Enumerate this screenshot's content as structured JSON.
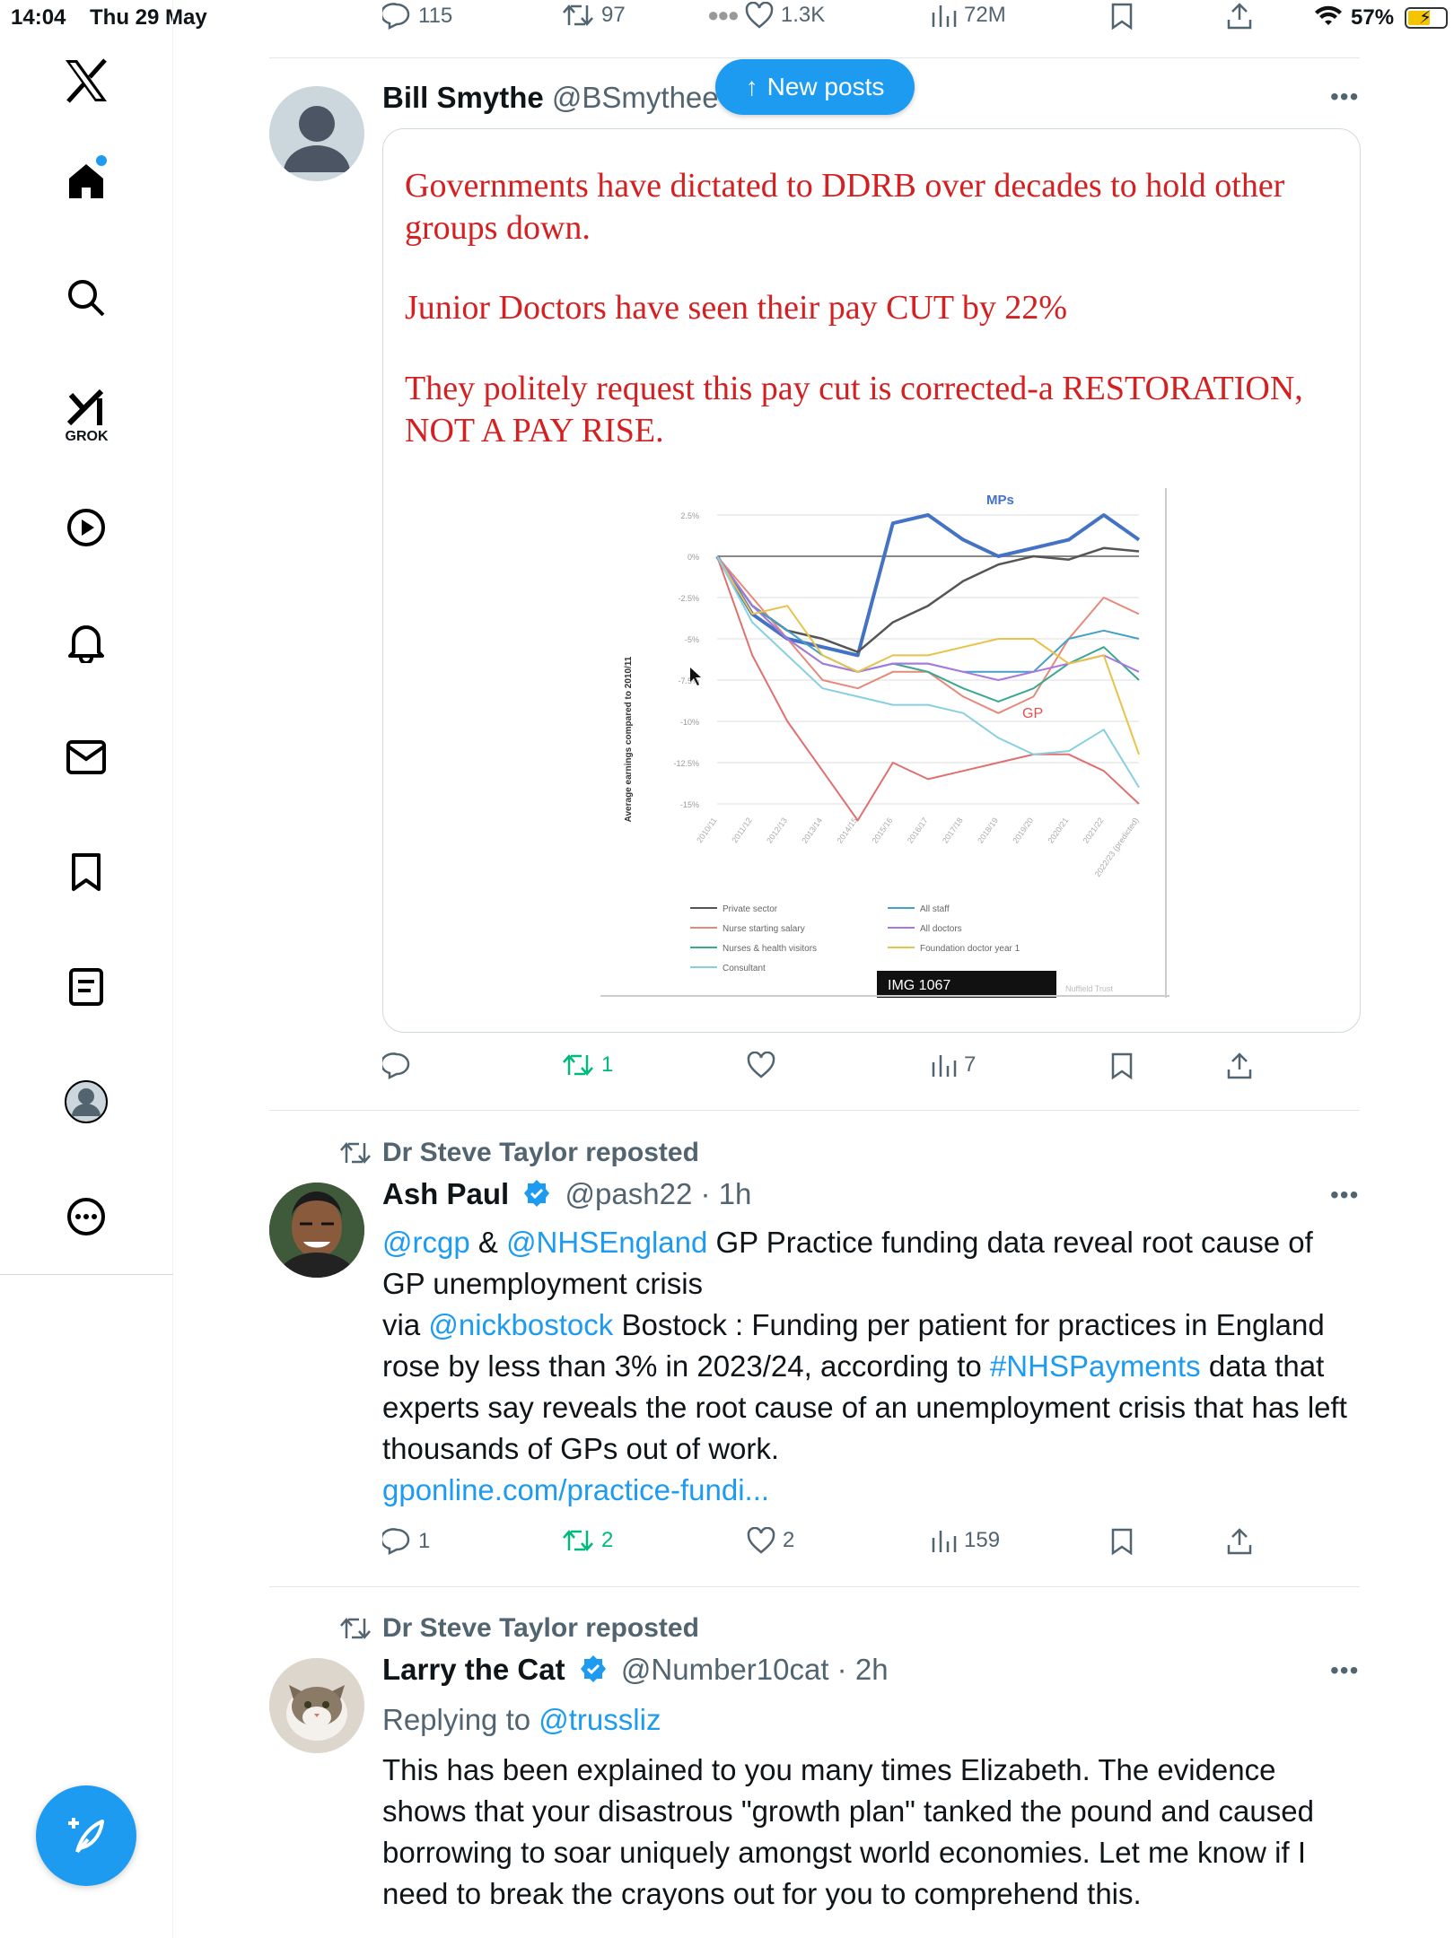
{
  "status": {
    "time": "14:04",
    "date": "Thu 29 May",
    "battery": "57%"
  },
  "sidebar": {
    "grok_label": "GROK"
  },
  "top_actions": {
    "replies": "115",
    "reposts": "97",
    "likes": "1.3K",
    "views": "72M"
  },
  "new_posts_label": "New posts",
  "tweet1": {
    "name": "Bill Smythe",
    "handle": "@BSmythee",
    "text1": "Governments have dictated to DDRB over decades to hold other groups down.",
    "text2": "Junior Doctors have seen their pay CUT by 22%",
    "text3": "They politely request this pay cut is corrected-a RESTORATION, NOT A PAY RISE.",
    "reposts": "1",
    "views": "7",
    "chart": {
      "ylabel": "Average earnings compared to 2010/11",
      "yticks": [
        "2.5%",
        "0%",
        "-2.5%",
        "-5%",
        "-7.5%",
        "-10%",
        "-12.5%",
        "-15%"
      ],
      "xticks": [
        "2010/11",
        "2011/12",
        "2012/13",
        "2013/14",
        "2014/15",
        "2015/16",
        "2016/17",
        "2017/18",
        "2018/19",
        "2019/20",
        "2020/21",
        "2021/22",
        "2022/23 (predicted)"
      ],
      "label_mps": "MPs",
      "label_gp": "GP",
      "legend": [
        "Private sector",
        "Nurse starting salary",
        "Nurses & health visitors",
        "Consultant",
        "All staff",
        "All doctors",
        "Foundation doctor year 1"
      ],
      "img_label": "IMG 1067",
      "source": "Nuffield Trust"
    }
  },
  "tweet2": {
    "reposted_by": "Dr Steve Taylor reposted",
    "name": "Ash Paul",
    "handle": "@pash22",
    "time": "1h",
    "mention1": "@rcgp",
    "amp": " & ",
    "mention2": "@NHSEngland",
    "line1_rest": " GP Practice funding data reveal root cause of GP unemployment crisis",
    "via": "via ",
    "mention3": "@nickbostock",
    "body_a": " Bostock : Funding per patient for practices in England rose by less than 3% in 2023/24, according to ",
    "hashtag": "#NHSPayments",
    "body_b": " data that experts say reveals the root cause of an unemployment crisis that has left thousands of GPs out of work.",
    "link": "gponline.com/practice-fundi...",
    "replies": "1",
    "reposts": "2",
    "likes": "2",
    "views": "159"
  },
  "tweet3": {
    "reposted_by": "Dr Steve Taylor reposted",
    "name": "Larry the Cat",
    "handle": "@Number10cat",
    "time": "2h",
    "replying_prefix": "Replying to ",
    "replying_to": "@trussliz",
    "text": "This has been explained to you many times Elizabeth. The evidence shows that your disastrous \"growth plan\" tanked the pound and caused borrowing to soar uniquely amongst world economies. Let me know if I need to break the crayons out for you to comprehend this."
  }
}
